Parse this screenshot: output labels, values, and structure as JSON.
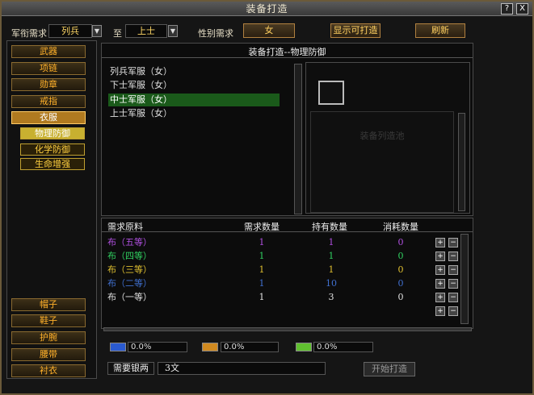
{
  "window": {
    "title": "装备打造",
    "help_label": "?",
    "close_label": "X"
  },
  "filters": {
    "rank_label": "军衔需求",
    "rank_from": "列兵",
    "to_label": "至",
    "rank_to": "上士",
    "gender_label": "性别需求",
    "gender_value": "女",
    "show_craftable_label": "显示可打造",
    "refresh_label": "刷新"
  },
  "sidebar": {
    "top_items": [
      "武器",
      "项链",
      "勋章",
      "戒指",
      "衣服"
    ],
    "sub_items": [
      "物理防御",
      "化学防御",
      "生命增强"
    ],
    "bottom_items": [
      "帽子",
      "鞋子",
      "护腕",
      "腰带",
      "衬衣"
    ]
  },
  "main": {
    "list_title": "装备打造--物理防御",
    "items": [
      "列兵军服（女）",
      "下士军服（女）",
      "中士军服（女）",
      "上士军服（女）"
    ],
    "preview_caption": "装备列造池"
  },
  "materials": {
    "headers": [
      "需求原料",
      "需求数量",
      "持有数量",
      "消耗数量"
    ],
    "rows": [
      {
        "name": "布（五等）",
        "need": "1",
        "have": "1",
        "use": "0",
        "color": "#b050e0"
      },
      {
        "name": "布（四等）",
        "need": "1",
        "have": "1",
        "use": "0",
        "color": "#30d060"
      },
      {
        "name": "布（三等）",
        "need": "1",
        "have": "1",
        "use": "0",
        "color": "#e0c030"
      },
      {
        "name": "布（二等）",
        "need": "1",
        "have": "10",
        "use": "0",
        "color": "#4070d0"
      },
      {
        "name": "布（一等）",
        "need": "1",
        "have": "3",
        "use": "0",
        "color": "#e0e0e0"
      }
    ]
  },
  "rates": [
    {
      "color": "#2a5ad0",
      "value": "0.0%"
    },
    {
      "color": "#d08a20",
      "value": "0.0%"
    },
    {
      "color": "#60c030",
      "value": "0.0%"
    }
  ],
  "cost": {
    "label": "需要银两",
    "value": "3文"
  },
  "start_label": "开始打造"
}
